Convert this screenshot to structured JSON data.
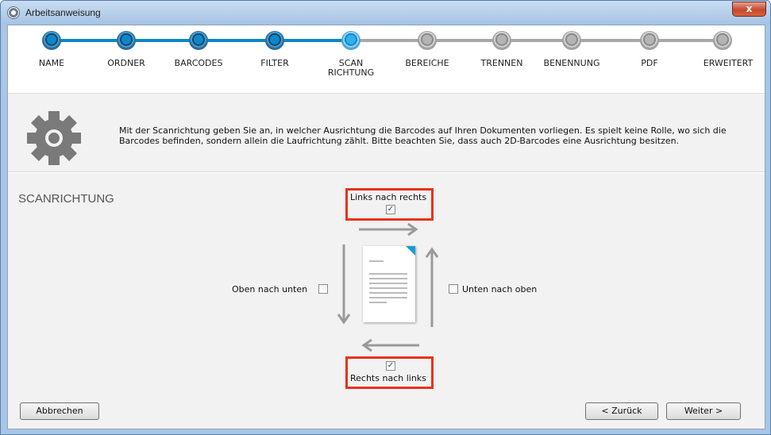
{
  "window": {
    "title": "Arbeitsanweisung",
    "close_label": "x"
  },
  "stepper": {
    "steps": [
      {
        "label": "NAME",
        "state": "done"
      },
      {
        "label": "ORDNER",
        "state": "done"
      },
      {
        "label": "BARCODES",
        "state": "done"
      },
      {
        "label": "FILTER",
        "state": "done"
      },
      {
        "label": "SCAN\nRICHTUNG",
        "state": "current"
      },
      {
        "label": "BEREICHE",
        "state": "pending"
      },
      {
        "label": "TRENNEN",
        "state": "pending"
      },
      {
        "label": "BENENNUNG",
        "state": "pending"
      },
      {
        "label": "PDF",
        "state": "pending"
      },
      {
        "label": "ERWEITERT",
        "state": "pending"
      }
    ],
    "colors": {
      "done": "#0d87c9",
      "current": "#2db2ee",
      "pending": "#a8a8a8"
    }
  },
  "info": {
    "icon": "gear-icon",
    "text_line1": "Mit der Scanrichtung geben Sie an, in welcher Ausrichtung die Barcodes auf Ihren Dokumenten vorliegen. Es spielt keine Rolle, wo sich die",
    "text_line2": "Barcodes befinden, sondern allein die Laufrichtung zählt. Bitte beachten Sie, dass auch 2D-Barcodes eine Ausrichtung besitzen."
  },
  "section": {
    "title": "SCANRICHTUNG"
  },
  "options": {
    "left_to_right": {
      "label": "Links nach rechts",
      "checked": true
    },
    "top_to_bottom": {
      "label": "Oben nach unten",
      "checked": false
    },
    "bottom_to_top": {
      "label": "Unten nach oben",
      "checked": false
    },
    "right_to_left": {
      "label": "Rechts nach links",
      "checked": true
    }
  },
  "buttons": {
    "cancel": "Abbrechen",
    "back": "< Zurück",
    "next": "Weiter >"
  },
  "colors": {
    "highlight": "#e8321a",
    "arrow": "#9a9a9a",
    "accent": "#1c9ad6"
  }
}
